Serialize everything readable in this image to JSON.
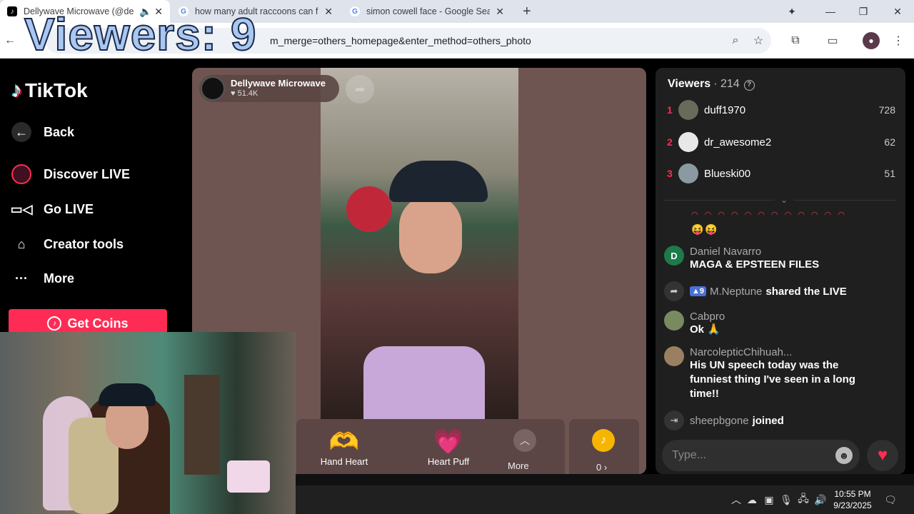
{
  "browser": {
    "tabs": [
      {
        "title": "Dellywave Microwave (@de",
        "active": true,
        "favicon": "tiktok-icon"
      },
      {
        "title": "how many adult raccoons can fi",
        "active": false,
        "favicon": "google-icon"
      },
      {
        "title": "simon cowell face - Google Sea",
        "active": false,
        "favicon": "google-icon"
      }
    ],
    "new_tab": "+",
    "url": "…/live?enter_from_merge=others_homepage&enter_method=others_photo",
    "url_visible_suffix": "m_merge=others_homepage&enter_method=others_photo"
  },
  "overlay": {
    "viewers_text": "Viewers: 9"
  },
  "sidebar": {
    "brand": "TikTok",
    "back": "Back",
    "items": [
      {
        "label": "Discover LIVE",
        "icon": "avatar-icon"
      },
      {
        "label": "Go LIVE",
        "icon": "video-camera-icon"
      },
      {
        "label": "Creator tools",
        "icon": "creator-tools-icon"
      },
      {
        "label": "More",
        "icon": "more-dots-icon"
      }
    ],
    "get_coins": "Get Coins"
  },
  "stream": {
    "host_name": "Dellywave Microwave",
    "host_likes": "51.4K",
    "gifts": [
      {
        "label": "Hand Heart",
        "icon": "🫶"
      },
      {
        "label": "Heart Puff",
        "icon": "💗"
      }
    ],
    "more_label": "More",
    "coin_count": "0 ›"
  },
  "panel": {
    "title": "Viewers",
    "count": "· 214",
    "top_viewers": [
      {
        "rank": "1",
        "name": "duff1970",
        "score": "728",
        "color": "#6a6a5a"
      },
      {
        "rank": "2",
        "name": "dr_awesome2",
        "score": "62",
        "color": "#e8e8e8"
      },
      {
        "rank": "3",
        "name": "Blueski00",
        "score": "51",
        "color": "#8a9aa0"
      }
    ],
    "emoji_row": "◠ ◠ ◠ ◠ ◠ ◠ ◠ ◠ ◠ ◠ ◠ ◠",
    "emoji_row2": "😝😝",
    "messages": [
      {
        "type": "chat",
        "avatar": "D",
        "avatar_color": "#1e7a4a",
        "name": "Daniel Navarro",
        "text": "MAGA & EPSTEEN FILES"
      },
      {
        "type": "share",
        "badge": "9",
        "name": "M.Neptune",
        "action": "shared the LIVE"
      },
      {
        "type": "chat",
        "avatar": "",
        "avatar_color": "#7a8a60",
        "name": "Cabpro",
        "text": "Ok 🙏"
      },
      {
        "type": "chat",
        "avatar": "",
        "avatar_color": "#9a8060",
        "name": "NarcolepticChihuah...",
        "text": "His UN speech today was the funniest thing I've seen in a long time!!"
      },
      {
        "type": "join",
        "name": "sheepbgone",
        "action": "joined"
      }
    ],
    "input_placeholder": "Type..."
  },
  "taskbar": {
    "time": "10:55 PM",
    "date": "9/23/2025"
  }
}
